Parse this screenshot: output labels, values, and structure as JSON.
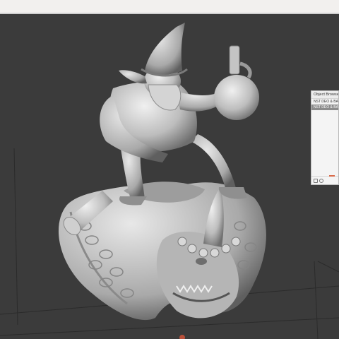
{
  "object_browser": {
    "title": "Object Browser",
    "items": [
      {
        "label": "NST DEO & BA...",
        "selected": false
      },
      {
        "label": "NST DEO & BA...",
        "selected": true
      }
    ]
  },
  "colors": {
    "viewport_bg": "#3b3b3b",
    "model": "#c9c9c9",
    "panel_bg": "#f4f4f4",
    "selection": "#8c8c8c",
    "accent": "#d96b4a"
  },
  "icons": [
    "camera-icon",
    "settings-icon"
  ]
}
